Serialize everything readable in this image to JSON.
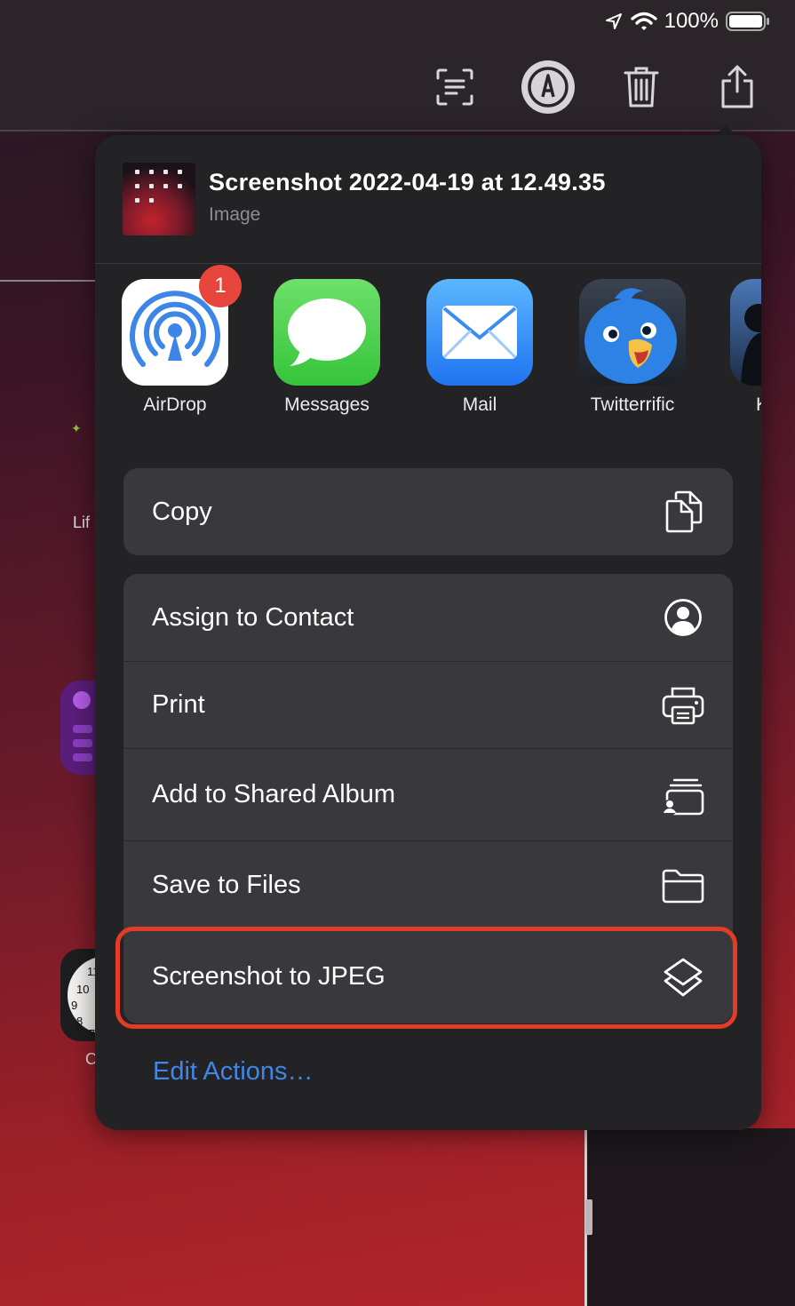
{
  "status_bar": {
    "battery": "100%",
    "icons": [
      "location-arrow-icon",
      "wifi-icon",
      "battery-icon"
    ]
  },
  "toolbar": {
    "icons": [
      "text-scan-icon",
      "markup-icon",
      "trash-icon",
      "share-icon"
    ]
  },
  "background": {
    "partial_label_1": "Lif",
    "partial_label_2": "C"
  },
  "share_sheet": {
    "file_title": "Screenshot 2022-04-19 at 12.49.35",
    "file_type": "Image",
    "apps": [
      {
        "label": "AirDrop",
        "icon": "airdrop-icon",
        "badge": "1"
      },
      {
        "label": "Messages",
        "icon": "messages-icon"
      },
      {
        "label": "Mail",
        "icon": "mail-icon"
      },
      {
        "label": "Twitterrific",
        "icon": "twitterrific-icon"
      },
      {
        "label": "K",
        "icon": "partial-app-icon"
      }
    ],
    "copy_group": [
      {
        "label": "Copy",
        "icon": "copy-icon"
      }
    ],
    "actions": [
      {
        "label": "Assign to Contact",
        "icon": "contact-icon"
      },
      {
        "label": "Print",
        "icon": "printer-icon"
      },
      {
        "label": "Add to Shared Album",
        "icon": "shared-album-icon"
      },
      {
        "label": "Save to Files",
        "icon": "folder-icon"
      },
      {
        "label": "Screenshot to JPEG",
        "icon": "shortcuts-icon",
        "highlighted": true
      }
    ],
    "edit_actions": "Edit Actions…"
  },
  "colors": {
    "highlight": "#e03c26",
    "link": "#3f87e6",
    "sheet_bg": "#232225",
    "row_bg": "#39383c"
  }
}
